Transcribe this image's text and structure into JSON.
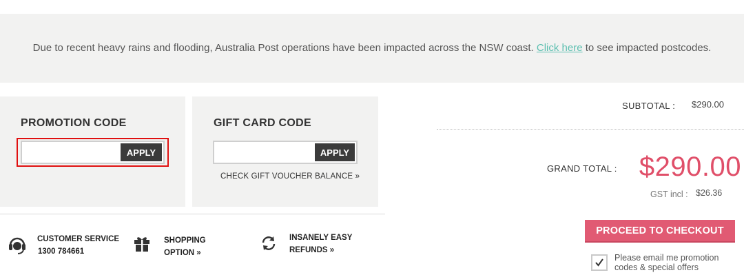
{
  "notice": {
    "text_before": "Due to recent heavy rains and flooding, Australia Post operations have been impacted across the NSW coast. ",
    "link_text": "Click here",
    "text_after": " to see impacted postcodes.",
    "link_color": "#5cbfb0"
  },
  "promotion": {
    "title": "PROMOTION CODE",
    "input_value": "",
    "input_placeholder": "",
    "apply_label": "APPLY"
  },
  "gift_card": {
    "title": "GIFT CARD CODE",
    "input_value": "",
    "input_placeholder": "",
    "apply_label": "APPLY",
    "balance_link": "CHECK GIFT VOUCHER BALANCE »"
  },
  "features": [
    {
      "icon": "headset-icon",
      "line1": "CUSTOMER SERVICE",
      "line2": "1300 784661"
    },
    {
      "icon": "gift-icon",
      "line1": "SHOPPING",
      "line2": "OPTION  »"
    },
    {
      "icon": "refresh-icon",
      "line1": "INSANELY EASY",
      "line2": "REFUNDS  »"
    }
  ],
  "summary": {
    "subtotal_label": "SUBTOTAL :",
    "subtotal_value": "$290.00",
    "grand_total_label": "GRAND TOTAL :",
    "grand_total_value": "$290.00",
    "gst_label": "GST incl :",
    "gst_value": "$26.36",
    "grand_total_color": "#e04f69"
  },
  "checkout": {
    "button_label": "PROCEED TO CHECKOUT",
    "button_color": "#e15a73"
  },
  "opt_in": {
    "checked": true,
    "label": "Please email me promotion codes & special offers"
  }
}
